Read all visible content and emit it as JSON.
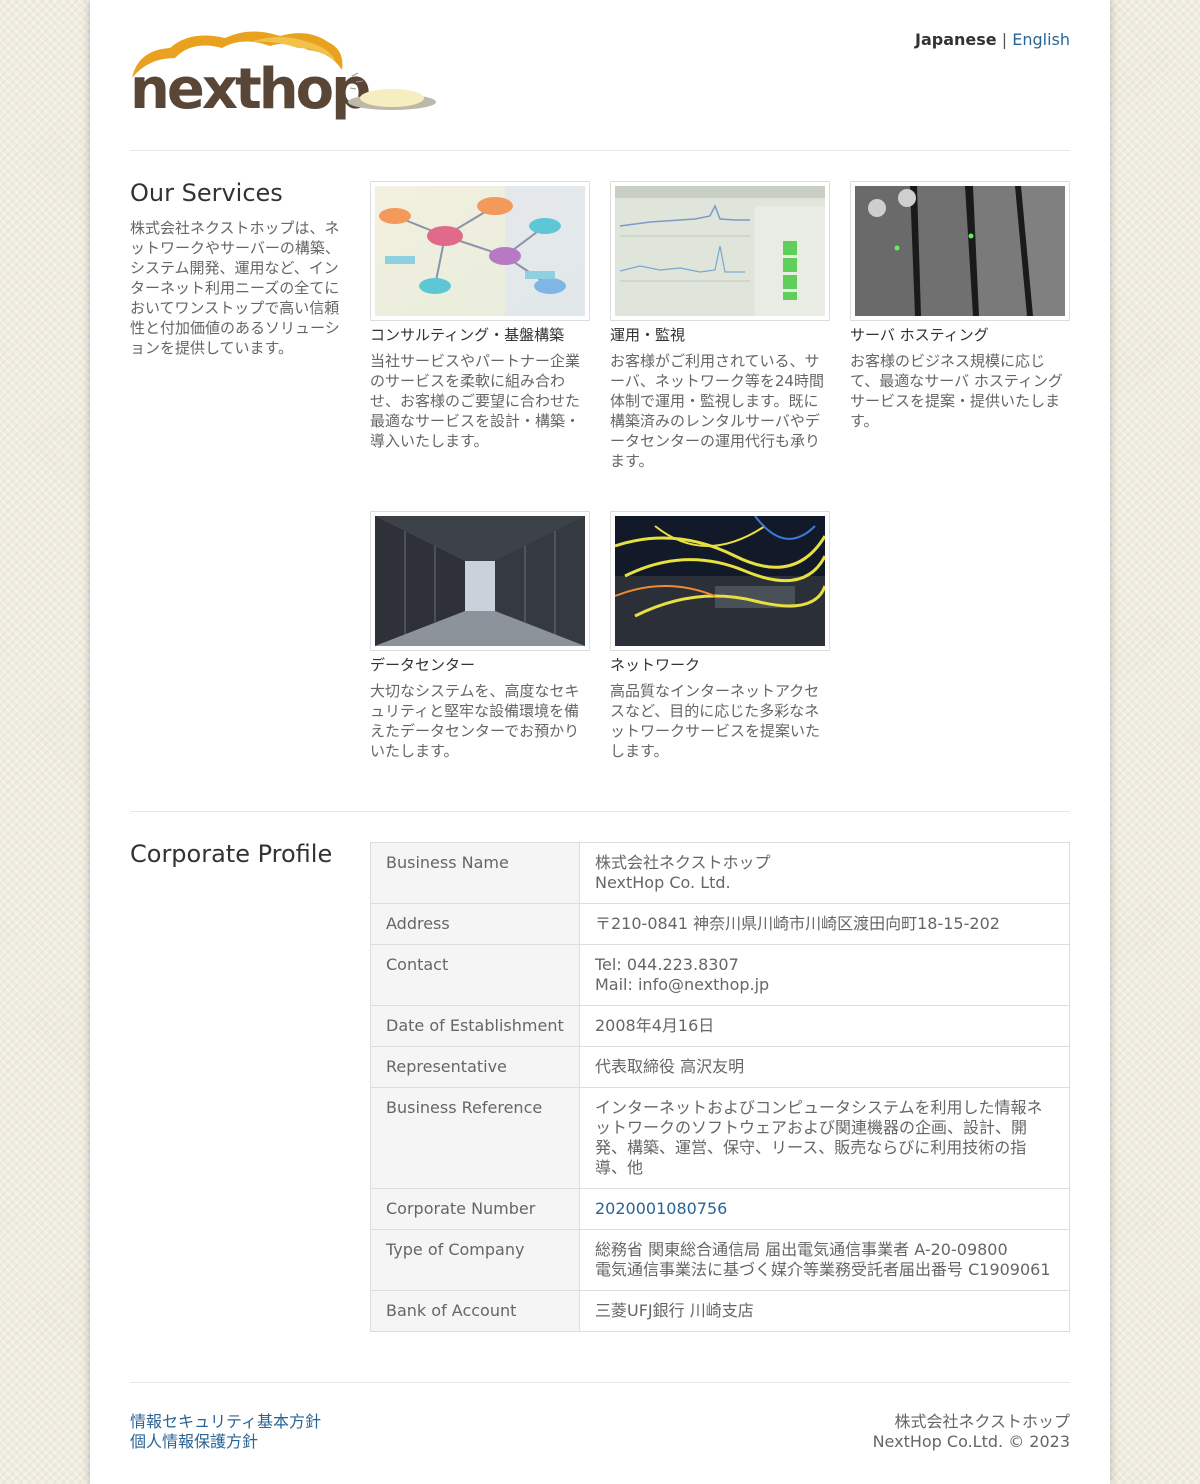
{
  "header": {
    "logo_text": "nexthop",
    "lang_current": "Japanese",
    "lang_separator": "|",
    "lang_other": "English"
  },
  "services": {
    "title": "Our Services",
    "intro": "株式会社ネクストホップは、ネットワークやサーバーの構築、システム開発、運用など、インターネット利用ニーズの全てにおいてワンストップで高い信頼性と付加価値のあるソリューションを提供しています。",
    "items": [
      {
        "title": "コンサルティング・基盤構築",
        "desc": "当社サービスやパートナー企業のサービスを柔軟に組み合わせ、お客様のご要望に合わせた最適なサービスを設計・構築・導入いたします。",
        "image": "mindmap-photo"
      },
      {
        "title": "運用・監視",
        "desc": "お客様がご利用されている、サーバ、ネットワーク等を24時間体制で運用・監視します。既に構築済みのレンタルサーバやデータセンターの運用代行も承ります。",
        "image": "monitor-photo"
      },
      {
        "title": "サーバ ホスティング",
        "desc": "お客様のビジネス規模に応じて、最適なサーバ ホスティングサービスを提案・提供いたします。",
        "image": "server-photo"
      },
      {
        "title": "データセンター",
        "desc": "大切なシステムを、高度なセキュリティと堅牢な設備環境を備えたデータセンターでお預かりいたします。",
        "image": "datacenter-photo"
      },
      {
        "title": "ネットワーク",
        "desc": "高品質なインターネットアクセスなど、目的に応じた多彩なネットワークサービスを提案いたします。",
        "image": "cables-photo"
      }
    ]
  },
  "profile": {
    "title": "Corporate Profile",
    "rows": [
      {
        "key": "Business Name",
        "lines": [
          "株式会社ネクストホップ",
          "NextHop Co. Ltd."
        ]
      },
      {
        "key": "Address",
        "lines": [
          "〒210-0841 神奈川県川崎市川崎区渡田向町18-15-202"
        ]
      },
      {
        "key": "Contact",
        "lines": [
          "Tel: 044.223.8307",
          "Mail: info@nexthop.jp"
        ]
      },
      {
        "key": "Date of Establishment",
        "lines": [
          "2008年4月16日"
        ]
      },
      {
        "key": "Representative",
        "lines": [
          "代表取締役 高沢友明"
        ]
      },
      {
        "key": "Business Reference",
        "lines": [
          "インターネットおよびコンピュータシステムを利用した情報ネットワークのソフトウェアおよび関連機器の企画、設計、開発、構築、運営、保守、リース、販売ならびに利用技術の指導、他"
        ]
      },
      {
        "key": "Corporate Number",
        "lines": [
          "2020001080756"
        ],
        "link": true
      },
      {
        "key": "Type of Company",
        "lines": [
          "総務省 関東総合通信局 届出電気通信事業者 A-20-09800",
          "電気通信事業法に基づく媒介等業務受託者届出番号 C1909061"
        ]
      },
      {
        "key": "Bank of Account",
        "lines": [
          "三菱UFJ銀行 川崎支店"
        ]
      }
    ]
  },
  "footer": {
    "links": [
      "情報セキュリティ基本方針",
      "個人情報保護方針"
    ],
    "company": "株式会社ネクストホップ",
    "copyright": "NextHop Co.Ltd. © 2023"
  },
  "colors": {
    "accent": "#2a6496",
    "logo_orange": "#e69a1e",
    "logo_brown": "#5a4636"
  }
}
